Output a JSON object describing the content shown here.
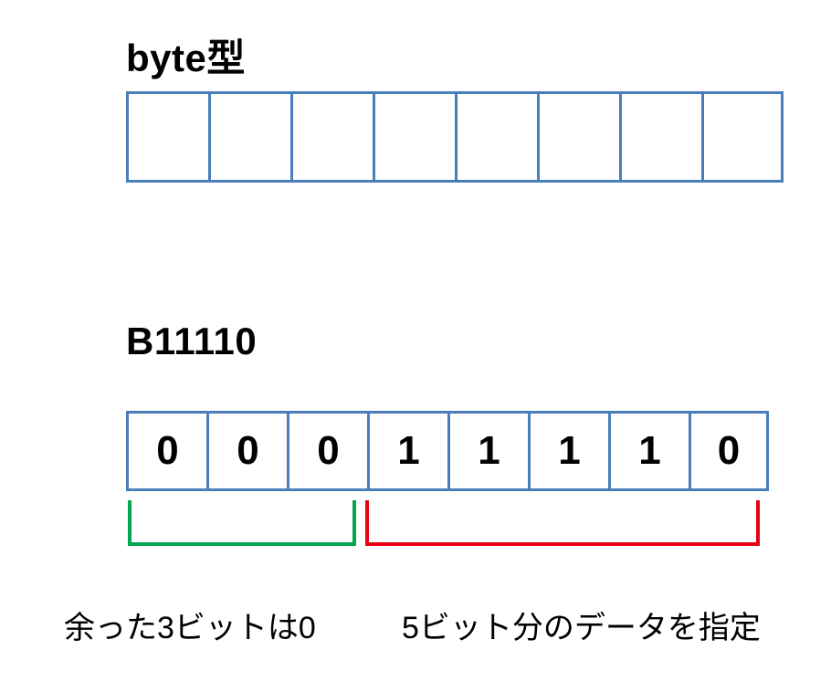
{
  "colors": {
    "cell_border": "#4a7ebb",
    "bracket_left": "#00a651",
    "bracket_right": "#e60012"
  },
  "top": {
    "title": "byte型",
    "bits": [
      "",
      "",
      "",
      "",
      "",
      "",
      "",
      ""
    ]
  },
  "bottom": {
    "title": "B11110",
    "bits": [
      "0",
      "0",
      "0",
      "1",
      "1",
      "1",
      "1",
      "0"
    ],
    "group_left": {
      "count": 3,
      "caption": "余った3ビットは0"
    },
    "group_right": {
      "count": 5,
      "caption": "5ビット分のデータを指定"
    }
  }
}
